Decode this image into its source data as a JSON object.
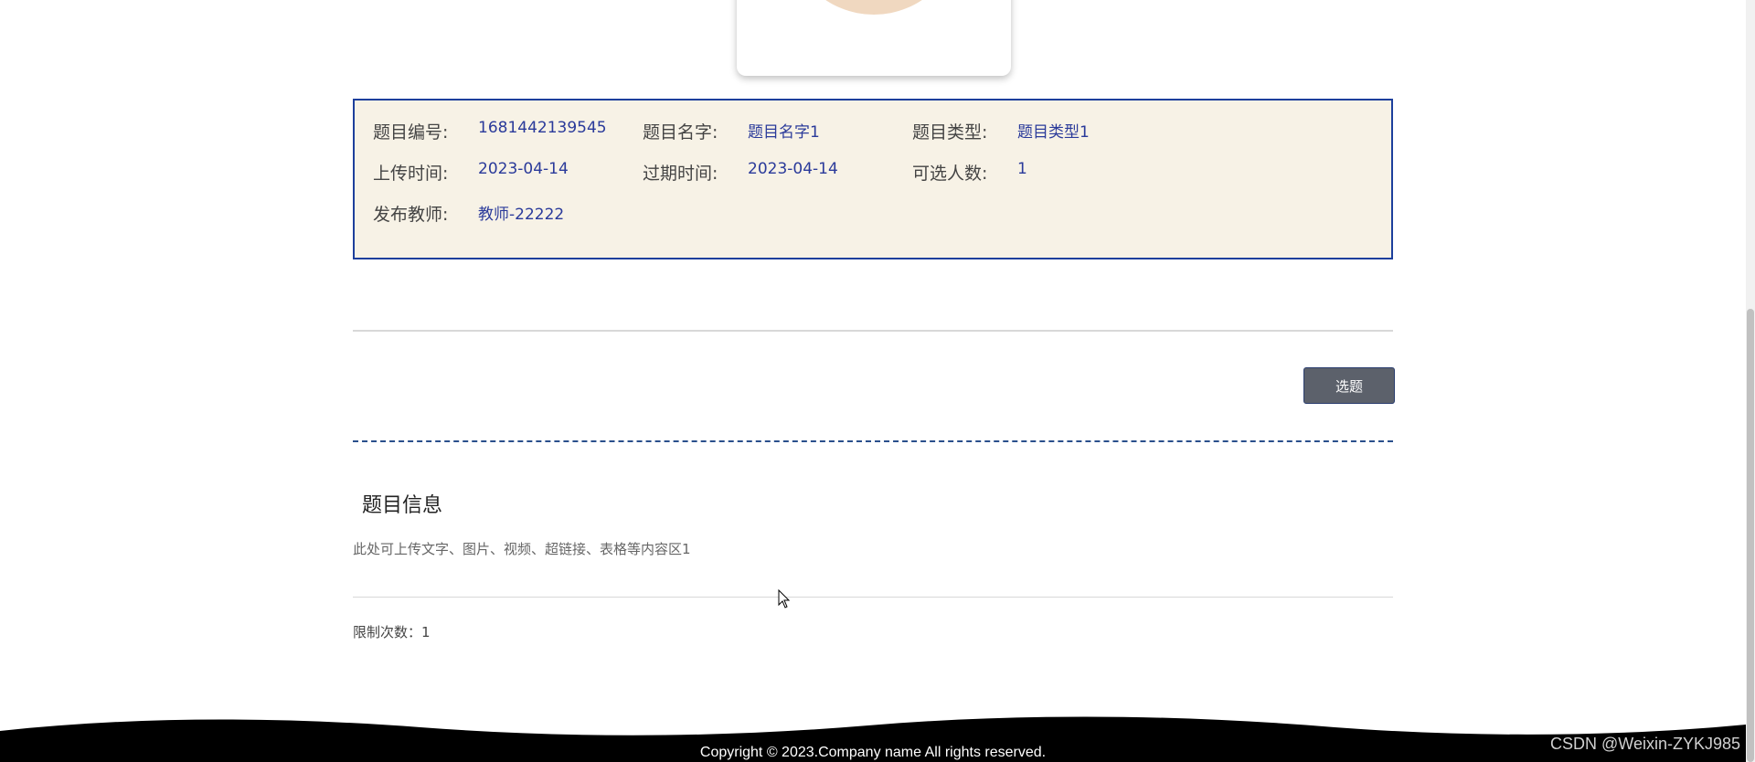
{
  "info": {
    "rows": [
      [
        {
          "label": "题目编号:",
          "value": "1681442139545"
        },
        {
          "label": "题目名字:",
          "value": "题目名字1"
        },
        {
          "label": "题目类型:",
          "value": "题目类型1"
        }
      ],
      [
        {
          "label": "上传时间:",
          "value": "2023-04-14"
        },
        {
          "label": "过期时间:",
          "value": "2023-04-14"
        },
        {
          "label": "可选人数:",
          "value": "1"
        }
      ],
      [
        {
          "label": "发布教师:",
          "value": "教师-22222"
        }
      ]
    ]
  },
  "actions": {
    "select_label": "选题"
  },
  "detail": {
    "title": "题目信息",
    "content": "此处可上传文字、图片、视频、超链接、表格等内容区1",
    "limit": "限制次数：1"
  },
  "footer": {
    "copyright": "Copyright © 2023.Company name All rights reserved.",
    "watermark": "CSDN @Weixin-ZYKJ985"
  },
  "colors": {
    "accent_border": "#1d3f9c",
    "info_bg": "#f7f2e6",
    "value_text": "#2a3a9a",
    "button_bg": "#5c616b"
  }
}
